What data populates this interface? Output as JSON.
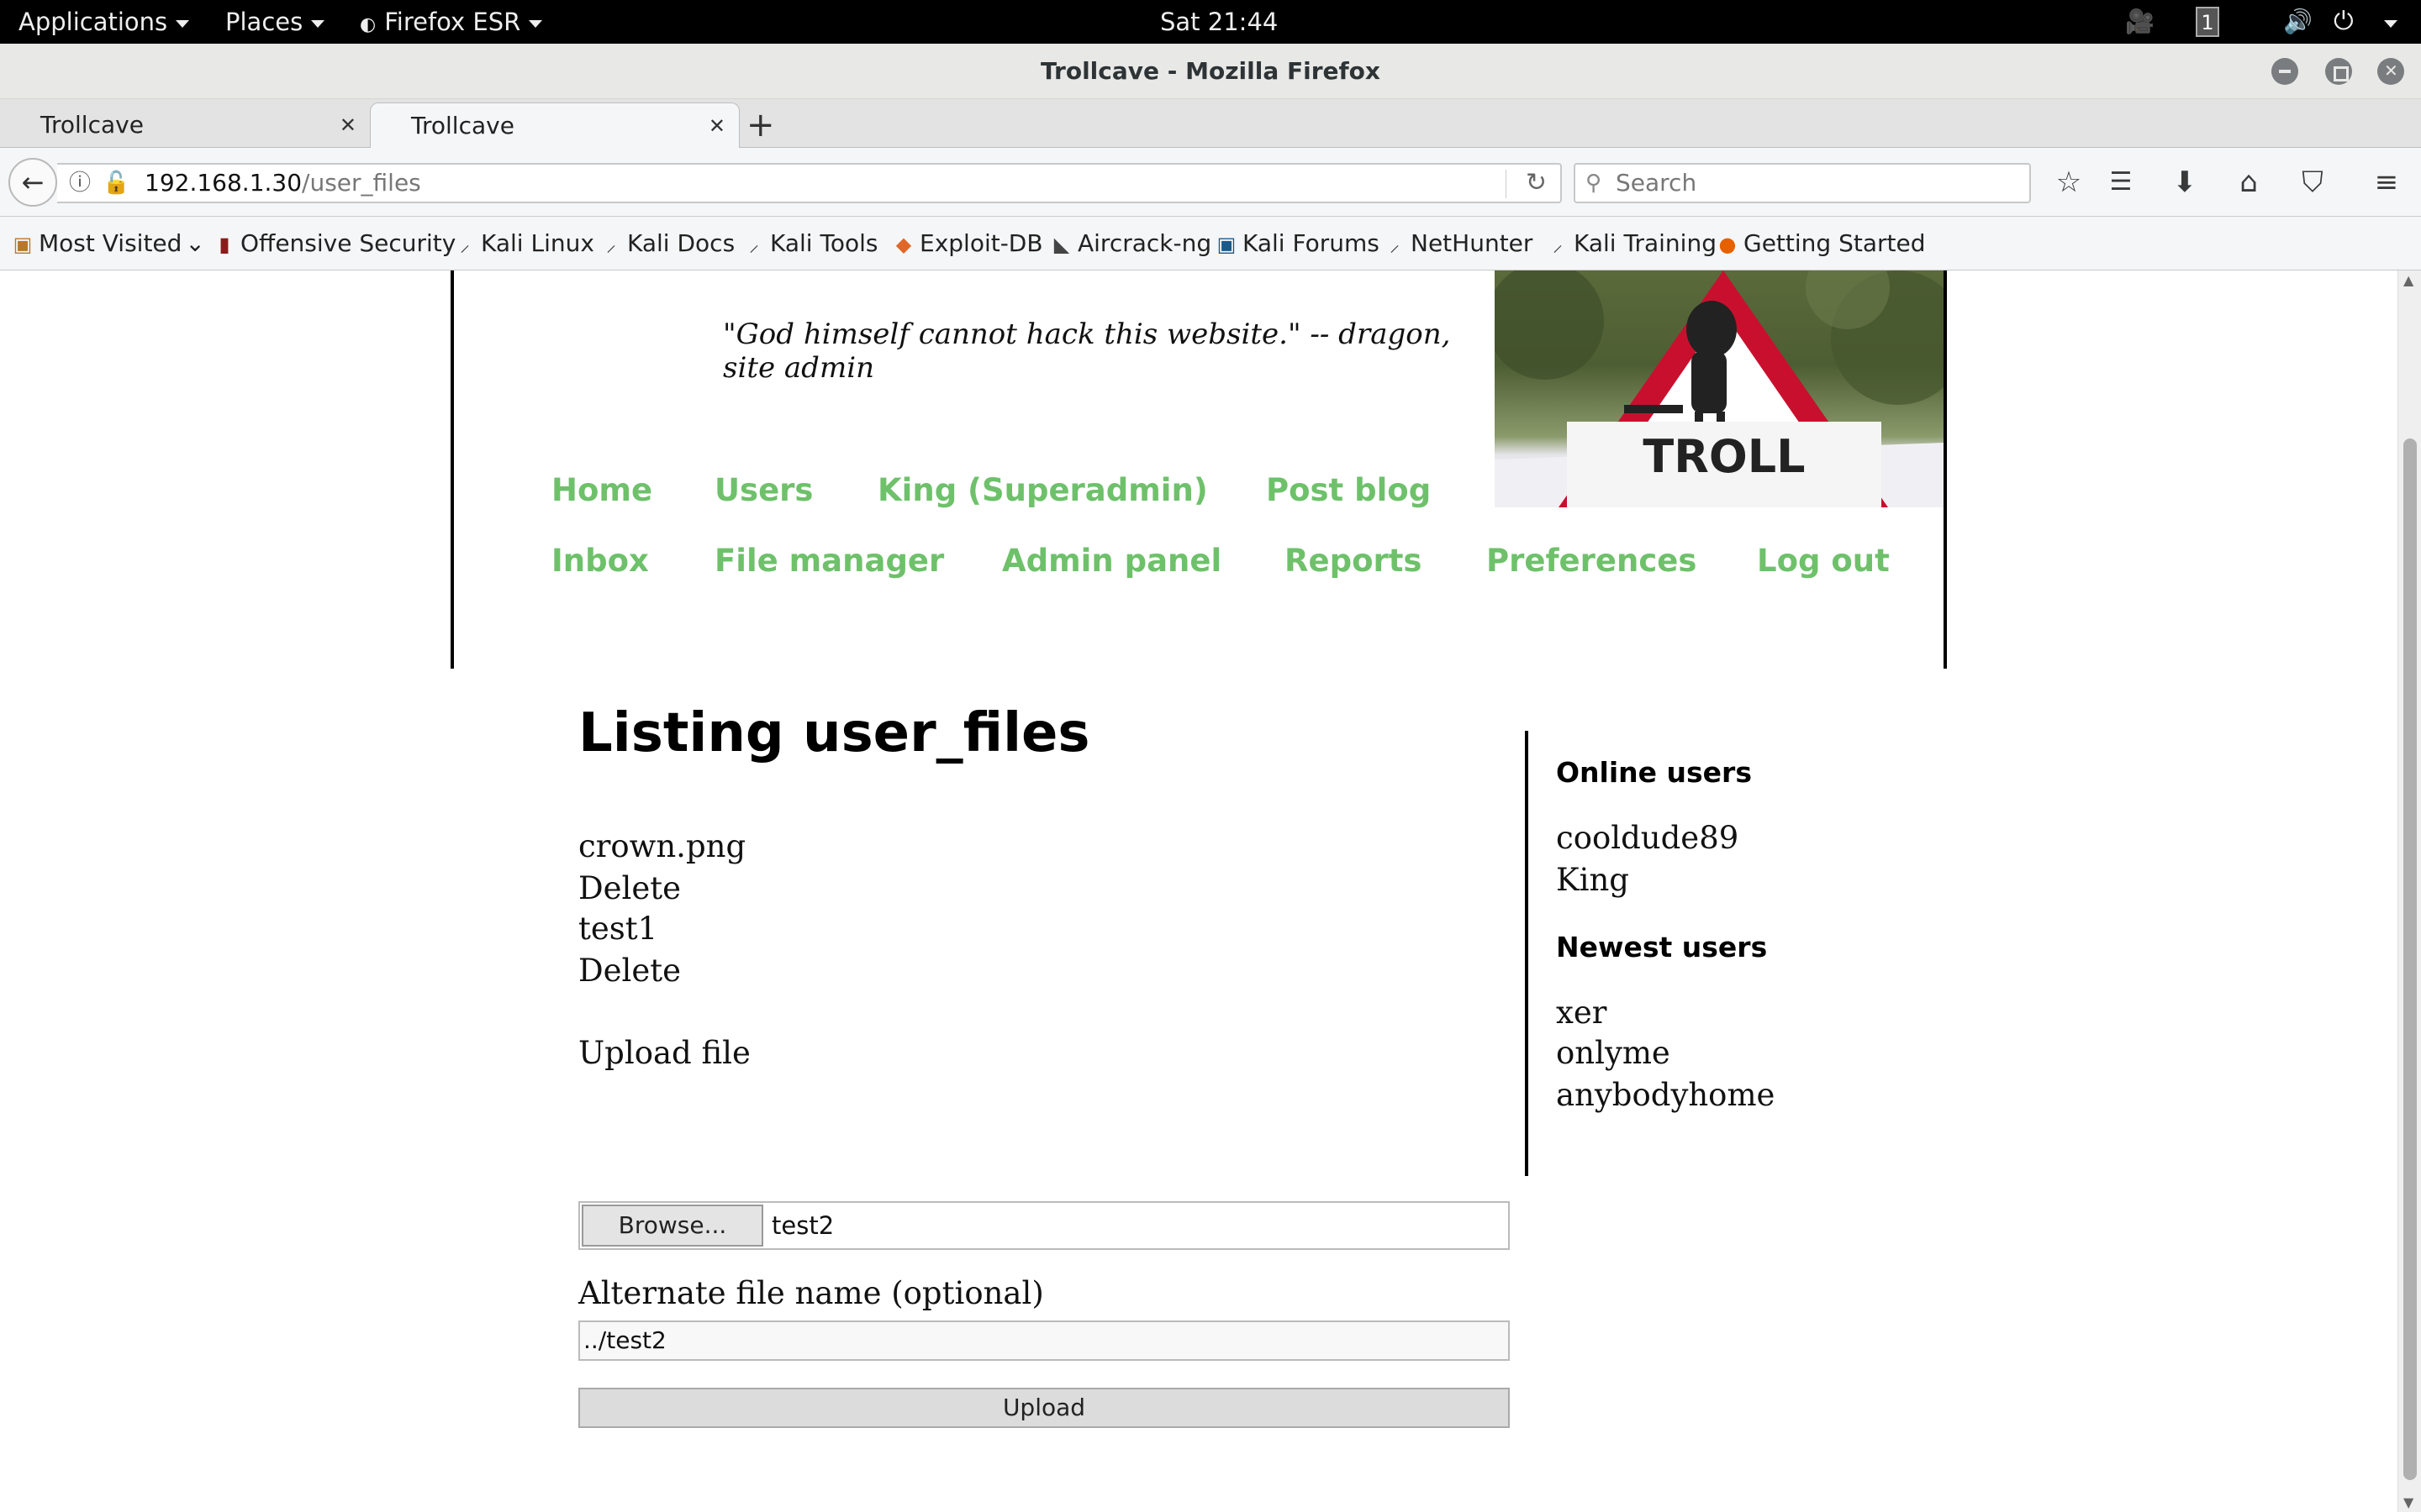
{
  "system_bar": {
    "applications": "Applications",
    "places": "Places",
    "firefox": "Firefox ESR",
    "clock": "Sat 21:44",
    "workspace": "1"
  },
  "window": {
    "title": "Trollcave - Mozilla Firefox"
  },
  "tabs": [
    {
      "label": "Trollcave"
    },
    {
      "label": "Trollcave"
    }
  ],
  "navigation": {
    "url_host": "192.168.1.30",
    "url_path": "/user_files",
    "search_placeholder": "Search"
  },
  "bookmarks": [
    {
      "label": "Most Visited",
      "icon": "folder-icon"
    },
    {
      "label": "Offensive Security",
      "icon": "offsec-icon"
    },
    {
      "label": "Kali Linux",
      "icon": "kali-icon"
    },
    {
      "label": "Kali Docs",
      "icon": "kali-icon"
    },
    {
      "label": "Kali Tools",
      "icon": "kali-icon"
    },
    {
      "label": "Exploit-DB",
      "icon": "exploitdb-icon"
    },
    {
      "label": "Aircrack-ng",
      "icon": "aircrack-icon"
    },
    {
      "label": "Kali Forums",
      "icon": "forums-icon"
    },
    {
      "label": "NetHunter",
      "icon": "kali-icon"
    },
    {
      "label": "Kali Training",
      "icon": "kali-icon"
    },
    {
      "label": "Getting Started",
      "icon": "firefox-icon"
    }
  ],
  "site": {
    "quote": "\"God himself cannot hack this website.\" -- dragon, site admin",
    "banner_text": "TROLL",
    "nav_row1": [
      "Home",
      "Users",
      "King (Superadmin)",
      "Post blog"
    ],
    "nav_row2": [
      "Inbox",
      "File manager",
      "Admin panel",
      "Reports",
      "Preferences",
      "Log out"
    ],
    "accent_color": "#6ec16a"
  },
  "main": {
    "title": "Listing user_files",
    "files": [
      {
        "name": "crown.png",
        "action": "Delete"
      },
      {
        "name": "test1",
        "action": "Delete"
      }
    ],
    "upload_heading": "Upload file",
    "browse_label": "Browse...",
    "selected_file": "test2",
    "alt_label": "Alternate file name (optional)",
    "alt_value": "../test2",
    "upload_button": "Upload"
  },
  "sidebar": {
    "online_heading": "Online users",
    "online_users": [
      "cooldude89",
      "King"
    ],
    "newest_heading": "Newest users",
    "newest_users": [
      "xer",
      "onlyme",
      "anybodyhome"
    ]
  }
}
